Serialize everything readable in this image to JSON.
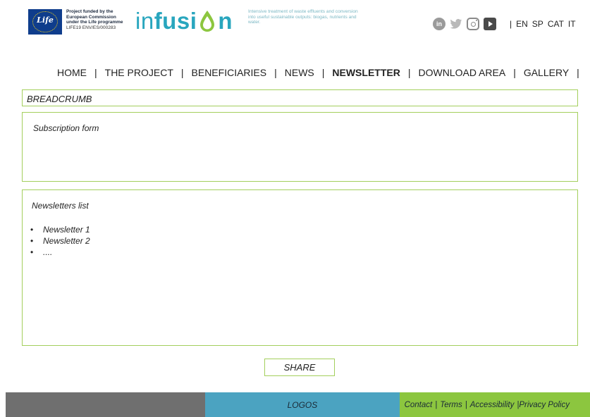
{
  "header": {
    "funded_lines": [
      "Project funded by the",
      "European Commission",
      "under the Life programme"
    ],
    "project_code": "LIFE19 ENV/ES/000283",
    "eu_logo_text": "Life",
    "logo_text_start": "in",
    "logo_text_bold": "fusi",
    "logo_text_end": "n",
    "tagline": "Intensive treatment of waste effluents and conversion into useful sustainable outputs: biogas, nutrients and water.",
    "social_icons": [
      "linkedin-icon",
      "twitter-icon",
      "instagram-icon",
      "youtube-icon"
    ],
    "languages": [
      "EN",
      "SP",
      "CAT",
      "IT"
    ]
  },
  "nav": {
    "items": [
      "HOME",
      "THE PROJECT",
      "BENEFICIARIES",
      "NEWS",
      "NEWSLETTER",
      "DOWNLOAD AREA",
      "GALLERY"
    ],
    "active": "NEWSLETTER"
  },
  "breadcrumb": "BREADCRUMB",
  "subscription": {
    "title": "Subscription form"
  },
  "newsletters": {
    "title": "Newsletters list",
    "items": [
      "Newsletter 1",
      "Newsletter 2",
      "...."
    ]
  },
  "share_label": "SHARE",
  "footer": {
    "logos_label": "LOGOS",
    "links": [
      "Contact",
      "Terms",
      "Accessibility",
      "Privacy Policy"
    ]
  },
  "colors": {
    "brand_teal": "#29a6be",
    "border_green": "#a3cf5c",
    "footer_grey": "#6f6f6f",
    "footer_blue": "#4ba3c1",
    "footer_green": "#8cc63f"
  }
}
